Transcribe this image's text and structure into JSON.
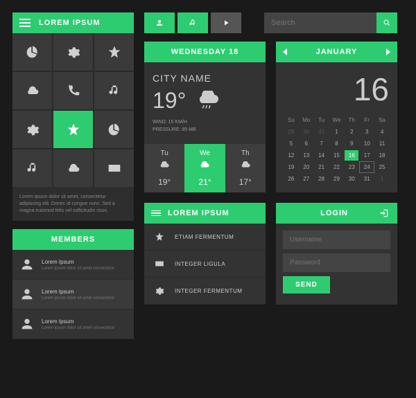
{
  "app": {
    "title": "LOREM IPSUM"
  },
  "desc": "Lorem ipsum dolor sit amet, consectetur adipiscing elit. Donec id congue nunc. Sed a magna euismod felis vel sollicitudin risus.",
  "search": {
    "placeholder": "Search"
  },
  "weather": {
    "date": "WEDNESDAY 18",
    "city": "CITY NAME",
    "temp": "19°",
    "wind": "WIND: 15 KM/H",
    "pressure": "PRESSURE: 85 MB",
    "forecast": [
      {
        "day": "Tu",
        "temp": "19°"
      },
      {
        "day": "We",
        "temp": "21°"
      },
      {
        "day": "Th",
        "temp": "17°"
      }
    ]
  },
  "calendar": {
    "month": "JANUARY",
    "today": "16",
    "dows": [
      "Su",
      "Mo",
      "Tu",
      "We",
      "Th",
      "Fr",
      "Sa"
    ],
    "cells": [
      {
        "n": "29",
        "dim": true
      },
      {
        "n": "30",
        "dim": true
      },
      {
        "n": "31",
        "dim": true
      },
      {
        "n": "1"
      },
      {
        "n": "2"
      },
      {
        "n": "3"
      },
      {
        "n": "4"
      },
      {
        "n": "5"
      },
      {
        "n": "6"
      },
      {
        "n": "7"
      },
      {
        "n": "8"
      },
      {
        "n": "9"
      },
      {
        "n": "10"
      },
      {
        "n": "11"
      },
      {
        "n": "12"
      },
      {
        "n": "13"
      },
      {
        "n": "14"
      },
      {
        "n": "15"
      },
      {
        "n": "16",
        "today": true
      },
      {
        "n": "17"
      },
      {
        "n": "18"
      },
      {
        "n": "19"
      },
      {
        "n": "20"
      },
      {
        "n": "21"
      },
      {
        "n": "22"
      },
      {
        "n": "23"
      },
      {
        "n": "24",
        "sel": true
      },
      {
        "n": "25"
      },
      {
        "n": "26"
      },
      {
        "n": "27"
      },
      {
        "n": "28"
      },
      {
        "n": "29"
      },
      {
        "n": "30"
      },
      {
        "n": "31"
      },
      {
        "n": "1",
        "dim": true
      }
    ]
  },
  "members": {
    "title": "MEMBERS",
    "items": [
      {
        "title": "Lorem Ipsum",
        "sub": "Lorem ipsum dolor sit amet consectetur"
      },
      {
        "title": "Lorem Ipsum",
        "sub": "Lorem ipsum dolor sit amet consectetur"
      },
      {
        "title": "Lorem Ipsum",
        "sub": "Lorem ipsum dolor sit amet consectetur"
      }
    ]
  },
  "menu": {
    "title": "LOREM IPSUM",
    "items": [
      {
        "label": "ETIAM FERMENTUM"
      },
      {
        "label": "INTEGER LIGULA"
      },
      {
        "label": "INTEGER FERMENTUM"
      }
    ]
  },
  "login": {
    "title": "LOGIN",
    "username": "Username",
    "password": "Password",
    "send": "SEND"
  }
}
